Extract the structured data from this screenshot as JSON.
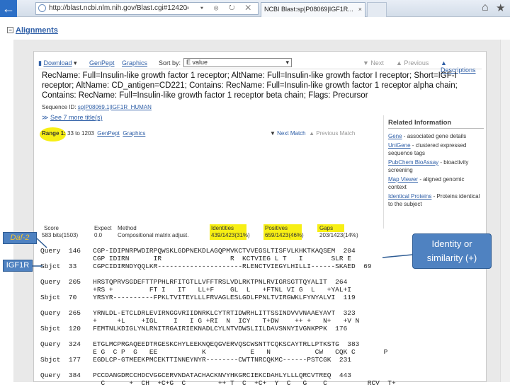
{
  "browser": {
    "back_label": "←",
    "url": "http://blast.ncbi.nlm.nih.gov/Blast.cgi#12420",
    "url_tools": "⌕ ▾ ⊗ ↻ ✕",
    "tab_title": "NCBI Blast:sp|P08069|IGF1R...",
    "tab_close": "×",
    "home_icon": "⌂",
    "favorites_icon": "★"
  },
  "section": {
    "toggle": "−",
    "title": "Alignments"
  },
  "toolbar": {
    "download": "Download",
    "genpept": "GenPept",
    "graphics": "Graphics",
    "sort_label": "Sort by:",
    "sort_value": "E value",
    "next": "▼ Next",
    "previous": "▲ Previous",
    "descriptions": "Descriptions"
  },
  "hit": {
    "title": "RecName: Full=Insulin-like growth factor 1 receptor; AltName: Full=Insulin-like growth factor I receptor; Short=IGF-I receptor; AltName: CD_antigen=CD221; Contains: RecName: Full=Insulin-like growth factor 1 receptor alpha chain; Contains: RecName: Full=Insulin-like growth factor 1 receptor beta chain; Flags: Precursor",
    "sequence_id_label": "Sequence ID:",
    "sequence_id": "sp|P08069.1|IGF1R_HUMAN",
    "see_more": "See 7 more title(s)",
    "range_label": "Range 1:",
    "range_value": "33 to 1203",
    "range_genpept": "GenPept",
    "range_graphics": "Graphics",
    "next_match": "Next Match",
    "previous_match": "Previous Match"
  },
  "related": {
    "heading": "Related Information",
    "items": [
      {
        "link": "Gene",
        "text": " - associated gene details"
      },
      {
        "link": "UniGene",
        "text": " - clustered expressed sequence tags"
      },
      {
        "link": "PubChem BioAssay",
        "text": " - bioactivity screening"
      },
      {
        "link": "Map Viewer",
        "text": " - aligned genomic context"
      },
      {
        "link": "Identical Proteins",
        "text": " - Proteins identical to the subject"
      }
    ]
  },
  "scores": {
    "headers": [
      "Score",
      "Expect",
      "Method",
      "Identities",
      "Positives",
      "Gaps"
    ],
    "values": [
      "583 bits(1503)",
      "0.0",
      "Compositional matrix adjust.",
      "439/1423(31%)",
      "659/1423(46%)",
      "203/1423(14%)"
    ]
  },
  "alignment": [
    "Query  146   CGP-IDIPNRPWDIRPQWSKLGDPNEKDLAGQPMVKCTVVEGSLTISFVLKHKTKAQSEM  204",
    "             CGP IDIRN      IR                 R  KCTVIEG L T   I       SLR E",
    "Sbjct  33    CGPCIDIRNDYQQLKR---------------------RLENCTVIEGYLHILLI------SKAED  69",
    "",
    "Query  205   HRSTQPRVSGDEFTTPPHLRFITGTLLVFFTRSLVDLRKTPNLRVIGRSGTTQYALIT  264",
    "             +RS +         FT I   IT   LL+F    GL  L   +FTNL VI G  L   +YAL+I",
    "Sbjct  70    YRSYR----------FPKLTVITEYLLLFRVAGLESLGDLFPNLTVIRGWKLFYNYALVI  119",
    "",
    "Query  265   YRNLDL-ETCLDRLEVIRNGGVRIIDNRKLCYTRTIDWRHLITTSSINDVVVNAAEYAVT  323",
    "             +     +L    +IGL    I   I G +RI  N  ICY   T+DW    ++ +   N+   +V N",
    "Sbjct  120   FEMTNLKDIGLYNLRNITRGAIRIEKNADLCYLNTVDWSLIILDAVSNNYIVGNKPPK  176",
    "",
    "Query  324   ETGLMCPRGAQEEDTRGESKCHYLEEKNQEQGVERVQSCWSNTTCQKSCAYTRLLPTKSTG  383",
    "             E G  C P  G   EE           K           E   N           CW   CQK C       P",
    "Sbjct  177   EGDLCP-GTMEEKPMCEKTTINNEYNYR--------CWTTNRCQKMC------PSTCGK  231",
    "",
    "Query  384   PCCDANGDRCCHDCVGGCERVNDATACHACKNVYHKGRCIEKCDAHLYLLLQRCVTREQ  443",
    "               C      +  CH  +C+G  C        ++ T  C  +C+  Y  C   G    C          RCV  T+"
  ]
}
